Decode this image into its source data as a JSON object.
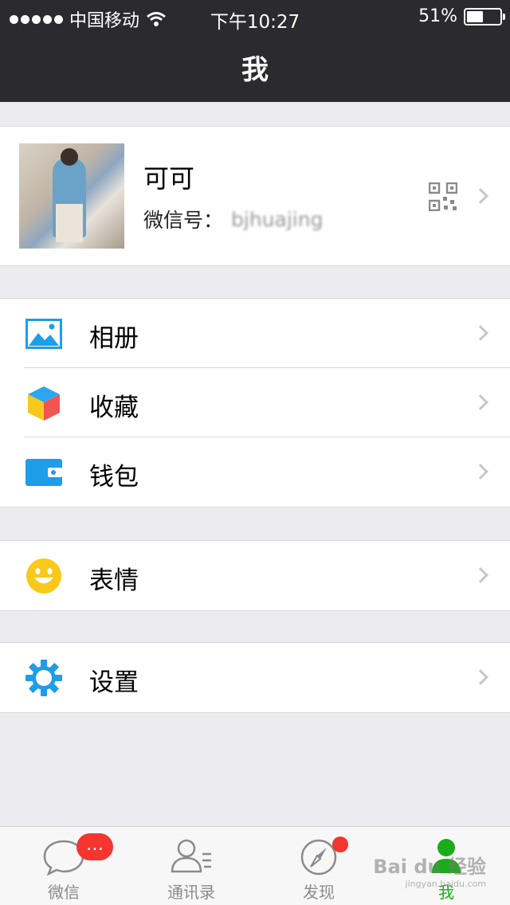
{
  "status_bar": {
    "carrier": "中国移动",
    "time": "下午10:27",
    "battery_percent": "51%",
    "battery_level": 0.51
  },
  "nav": {
    "title": "我"
  },
  "profile": {
    "name": "可可",
    "wechat_id_label": "微信号：",
    "wechat_id_value": "bjhuajing"
  },
  "menu": {
    "album": "相册",
    "favorites": "收藏",
    "wallet": "钱包",
    "stickers": "表情",
    "settings": "设置"
  },
  "tabs": [
    {
      "label": "微信",
      "badge": "…"
    },
    {
      "label": "通讯录"
    },
    {
      "label": "发现"
    },
    {
      "label": "我"
    }
  ],
  "watermark": {
    "text": "Bai du 经验",
    "sub": "jingyan.baidu.com"
  },
  "colors": {
    "accent_green": "#1aad19",
    "badge_red": "#f43530",
    "icon_blue": "#1e9de8",
    "nav_bg": "#2b2b2f"
  }
}
